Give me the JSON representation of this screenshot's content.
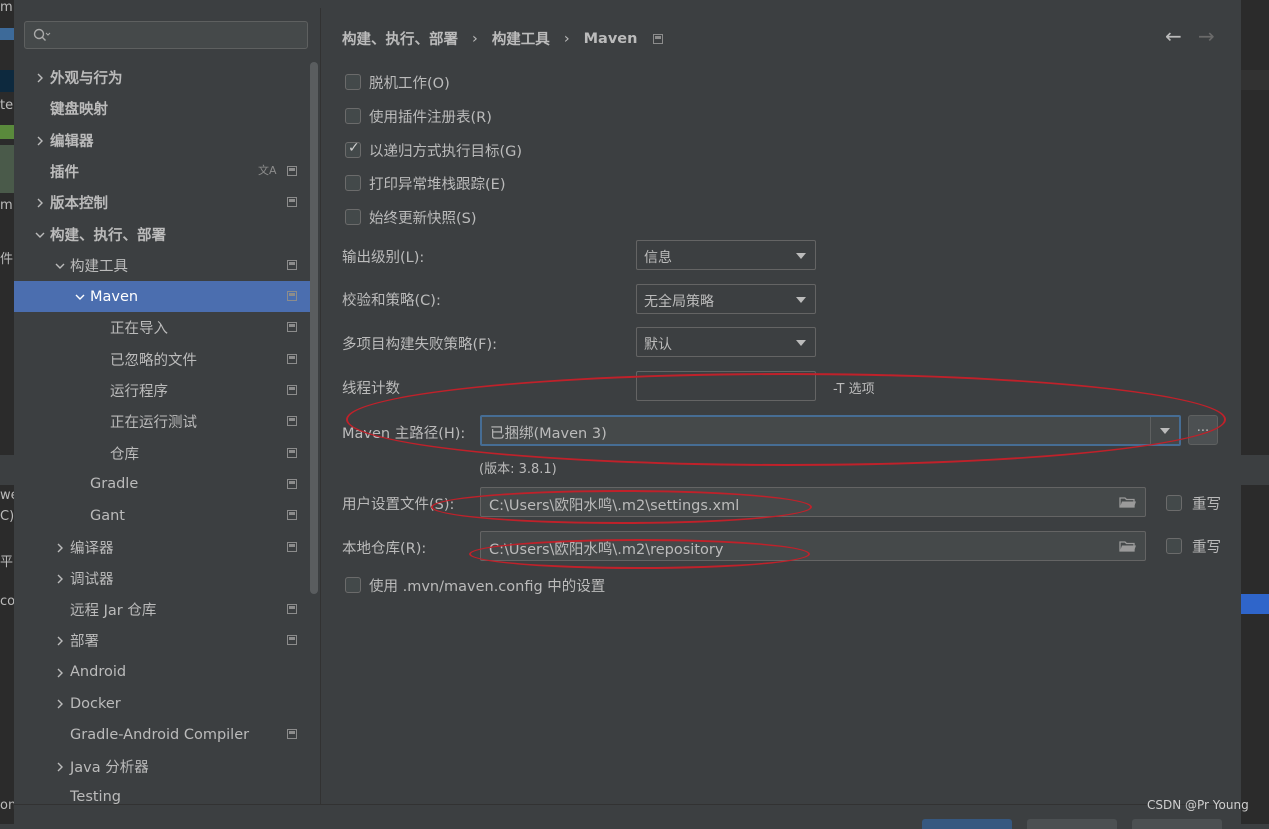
{
  "ide_fragments": [
    "m",
    "te",
    "m",
    "件",
    "we",
    "C)",
    "平",
    "co",
    "on"
  ],
  "search": {
    "placeholder": ""
  },
  "tree": [
    {
      "label": "外观与行为",
      "bold": true,
      "chevron": "right",
      "level": 0
    },
    {
      "label": "键盘映射",
      "bold": true,
      "chevron": "none",
      "level": 0
    },
    {
      "label": "编辑器",
      "bold": true,
      "chevron": "right",
      "level": 0
    },
    {
      "label": "插件",
      "bold": true,
      "chevron": "none",
      "level": 0,
      "icon": "translate-icon",
      "project": true
    },
    {
      "label": "版本控制",
      "bold": true,
      "chevron": "right",
      "level": 0,
      "project": true
    },
    {
      "label": "构建、执行、部署",
      "bold": true,
      "chevron": "down",
      "level": 0
    },
    {
      "label": "构建工具",
      "bold": false,
      "chevron": "down",
      "level": 1,
      "project": true
    },
    {
      "label": "Maven",
      "bold": false,
      "chevron": "down",
      "level": 2,
      "project": true,
      "selected": true
    },
    {
      "label": "正在导入",
      "bold": false,
      "chevron": "none",
      "level": 3,
      "project": true
    },
    {
      "label": "已忽略的文件",
      "bold": false,
      "chevron": "none",
      "level": 3,
      "project": true
    },
    {
      "label": "运行程序",
      "bold": false,
      "chevron": "none",
      "level": 3,
      "project": true
    },
    {
      "label": "正在运行测试",
      "bold": false,
      "chevron": "none",
      "level": 3,
      "project": true
    },
    {
      "label": "仓库",
      "bold": false,
      "chevron": "none",
      "level": 3,
      "project": true
    },
    {
      "label": "Gradle",
      "bold": false,
      "chevron": "none",
      "level": 2,
      "project": true
    },
    {
      "label": "Gant",
      "bold": false,
      "chevron": "none",
      "level": 2,
      "project": true
    },
    {
      "label": "编译器",
      "bold": false,
      "chevron": "right",
      "level": 1,
      "project": true
    },
    {
      "label": "调试器",
      "bold": false,
      "chevron": "right",
      "level": 1
    },
    {
      "label": "远程 Jar 仓库",
      "bold": false,
      "chevron": "none",
      "level": 1,
      "project": true
    },
    {
      "label": "部署",
      "bold": false,
      "chevron": "right",
      "level": 1,
      "project": true
    },
    {
      "label": "Android",
      "bold": false,
      "chevron": "right",
      "level": 1
    },
    {
      "label": "Docker",
      "bold": false,
      "chevron": "right",
      "level": 1
    },
    {
      "label": "Gradle-Android Compiler",
      "bold": false,
      "chevron": "none",
      "level": 1,
      "project": true
    },
    {
      "label": "Java 分析器",
      "bold": false,
      "chevron": "right",
      "level": 1
    },
    {
      "label": "Testing",
      "bold": false,
      "chevron": "none",
      "level": 1
    }
  ],
  "breadcrumb": {
    "part1": "构建、执行、部署",
    "sep": "›",
    "part2": "构建工具",
    "part3": "Maven"
  },
  "nav": {
    "back": "←",
    "forward": "→"
  },
  "checkboxes": {
    "offline": {
      "label": "脱机工作(O)",
      "checked": false
    },
    "plugin_registry": {
      "label": "使用插件注册表(R)",
      "checked": false
    },
    "recursive": {
      "label": "以递归方式执行目标(G)",
      "checked": true
    },
    "print_stack": {
      "label": "打印异常堆栈跟踪(E)",
      "checked": false
    },
    "update_snapshots": {
      "label": "始终更新快照(S)",
      "checked": false
    },
    "mvn_config": {
      "label": "使用 .mvn/maven.config 中的设置",
      "checked": false
    }
  },
  "fields": {
    "output_level": {
      "label": "输出级别(L):",
      "value": "信息"
    },
    "checksum_policy": {
      "label": "校验和策略(C):",
      "value": "无全局策略"
    },
    "fail_policy": {
      "label": "多项目构建失败策略(F):",
      "value": "默认"
    },
    "thread_count": {
      "label": "线程计数",
      "value": "",
      "suffix": "-T 选项"
    },
    "maven_home": {
      "label": "Maven 主路径(H):",
      "value": "已捆绑(Maven 3)",
      "browse": "...",
      "version": "(版本: 3.8.1)"
    },
    "user_settings": {
      "label": "用户设置文件(S):",
      "value": "C:\\Users\\欧阳水鸣\\.m2\\settings.xml",
      "override": "重写"
    },
    "local_repo": {
      "label": "本地仓库(R):",
      "value": "C:\\Users\\欧阳水鸣\\.m2\\repository",
      "override": "重写"
    }
  },
  "watermark": "CSDN @Pr Young",
  "colors": {
    "background": "#3c3f41",
    "selection": "#4b6eaf",
    "annotation": "#c0212a"
  }
}
